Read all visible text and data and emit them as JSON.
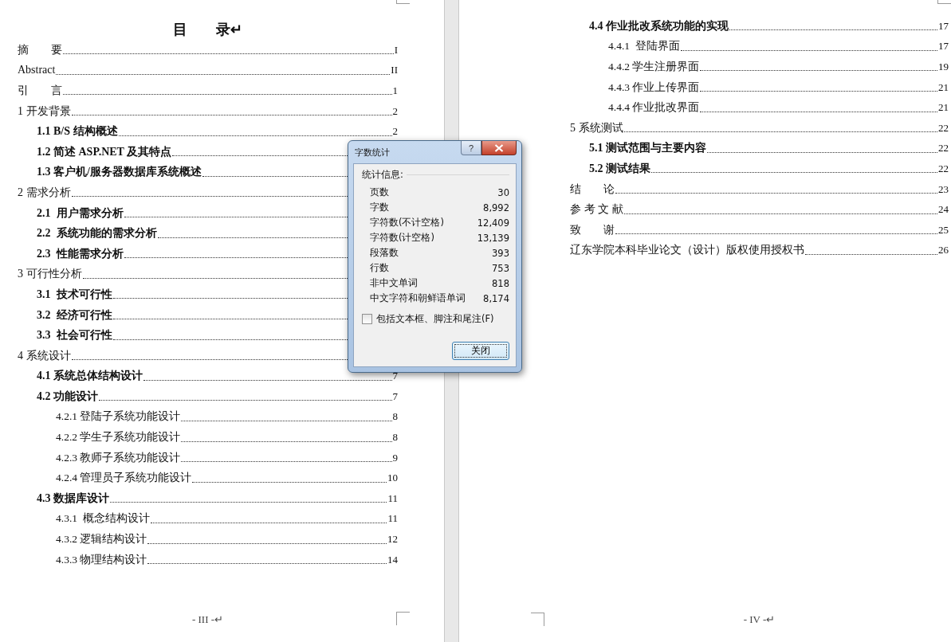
{
  "document": {
    "pages": [
      {
        "heading": "目　　录↵",
        "entries": [
          {
            "title": "摘　　要",
            "page": "I"
          },
          {
            "title": "Abstract",
            "page": "II"
          },
          {
            "title": "引　　言",
            "page": "1"
          },
          {
            "title": "1 开发背景",
            "page": "2",
            "children": [
              {
                "title": "1.1 B/S 结构概述",
                "page": "2"
              },
              {
                "title": "1.2 简述 ASP.NET 及其特点"
              },
              {
                "title": "1.3 客户机/服务器数据库系统概述"
              }
            ]
          },
          {
            "title": "2 需求分析",
            "children": [
              {
                "title": "2.1  用户需求分析"
              },
              {
                "title": "2.2  系统功能的需求分析"
              },
              {
                "title": "2.3  性能需求分析"
              }
            ]
          },
          {
            "title": "3 可行性分析",
            "children": [
              {
                "title": "3.1  技术可行性"
              },
              {
                "title": "3.2  经济可行性"
              },
              {
                "title": "3.3  社会可行性"
              }
            ]
          },
          {
            "title": "4 系统设计",
            "children": [
              {
                "title": "4.1 系统总体结构设计",
                "page": "7"
              },
              {
                "title": "4.2 功能设计",
                "page": "7",
                "children": [
                  {
                    "title": "4.2.1 登陆子系统功能设计",
                    "page": "8"
                  },
                  {
                    "title": "4.2.2 学生子系统功能设计",
                    "page": "8"
                  },
                  {
                    "title": "4.2.3 教师子系统功能设计",
                    "page": "9"
                  },
                  {
                    "title": "4.2.4 管理员子系统功能设计",
                    "page": "10"
                  }
                ]
              },
              {
                "title": "4.3 数据库设计",
                "page": "11",
                "children": [
                  {
                    "title": "4.3.1  概念结构设计",
                    "page": "11"
                  },
                  {
                    "title": "4.3.2 逻辑结构设计",
                    "page": "12"
                  },
                  {
                    "title": "4.3.3 物理结构设计",
                    "page": "14"
                  }
                ]
              }
            ]
          }
        ],
        "footer": "- III -↵"
      },
      {
        "entries": [
          {
            "children": [
              {
                "title": "4.4 作业批改系统功能的实现",
                "page": "17",
                "children": [
                  {
                    "title": "4.4.1  登陆界面",
                    "page": "17"
                  },
                  {
                    "title": "4.4.2 学生注册界面",
                    "page": "19"
                  },
                  {
                    "title": "4.4.3 作业上传界面",
                    "page": "21"
                  },
                  {
                    "title": "4.4.4 作业批改界面",
                    "page": "21"
                  }
                ]
              }
            ]
          },
          {
            "title": "5 系统测试",
            "page": "22",
            "children": [
              {
                "title": "5.1 测试范围与主要内容",
                "page": "22"
              },
              {
                "title": "5.2 测试结果",
                "page": "22"
              }
            ]
          },
          {
            "title": "结　　论",
            "page": "23"
          },
          {
            "title": "参 考 文 献",
            "page": "24"
          },
          {
            "title": "致　　谢",
            "page": "25"
          },
          {
            "title": "辽东学院本科毕业论文（设计）版权使用授权书",
            "page": "26"
          }
        ],
        "footer": "- IV -↵"
      }
    ]
  },
  "dialog": {
    "title": "字数统计",
    "help_button": "?",
    "group_label": "统计信息:",
    "stats": [
      {
        "label": "页数",
        "value": "30"
      },
      {
        "label": "字数",
        "value": "8,992"
      },
      {
        "label": "字符数(不计空格)",
        "value": "12,409"
      },
      {
        "label": "字符数(计空格)",
        "value": "13,139"
      },
      {
        "label": "段落数",
        "value": "393"
      },
      {
        "label": "行数",
        "value": "753"
      },
      {
        "label": "非中文单词",
        "value": "818"
      },
      {
        "label": "中文字符和朝鲜语单词",
        "value": "8,174"
      }
    ],
    "option": {
      "label": "包括文本框、脚注和尾注(F)",
      "checked": false
    },
    "button": "关闭"
  }
}
